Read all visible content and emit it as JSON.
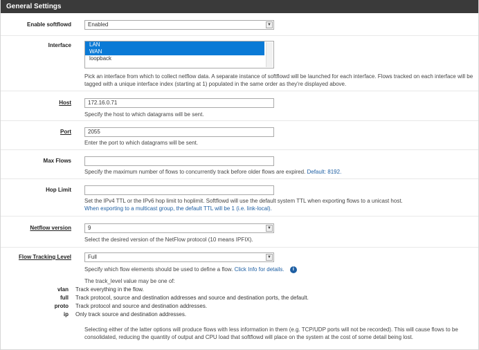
{
  "panel": {
    "title": "General Settings"
  },
  "enable": {
    "label": "Enable softflowd",
    "value": "Enabled"
  },
  "interface": {
    "label": "Interface",
    "options": [
      "LAN",
      "WAN",
      "loopback"
    ],
    "help": "Pick an interface from which to collect netflow data. A separate instance of softflowd will be launched for each interface. Flows tracked on each interface will be tagged with a unique interface index (starting at 1) populated in the same order as they're displayed above."
  },
  "host": {
    "label": "Host",
    "value": "172.16.0.71",
    "help": "Specify the host to which datagrams will be sent."
  },
  "port": {
    "label": "Port",
    "value": "2055",
    "help": "Enter the port to which datagrams will be sent."
  },
  "maxflows": {
    "label": "Max Flows",
    "value": "",
    "help": "Specify the maximum number of flows to concurrently track before older flows are expired.",
    "default_link": "Default: 8192."
  },
  "hoplimit": {
    "label": "Hop Limit",
    "value": "",
    "help": "Set the IPv4 TTL or the IPv6 hop limit to hoplimit. Softflowd will use the default system TTL when exporting flows to a unicast host.",
    "help_link": "When exporting to a multicast group, the default TTL will be 1 (i.e. link-local)."
  },
  "version": {
    "label": "Netflow version",
    "value": "9",
    "help": "Select the desired version of the NetFlow protocol (10 means IPFIX)."
  },
  "tracking": {
    "label": "Flow Tracking Level",
    "value": "Full",
    "help": "Specify which flow elements should be used to define a flow.",
    "help_link": "Click Info for details.",
    "intro": "The track_level value may be one of:",
    "levels": [
      {
        "key": "vlan",
        "desc": "Track everything in the flow."
      },
      {
        "key": "full",
        "desc": "Track protocol, source and destination addresses and source and destination ports, the default."
      },
      {
        "key": "proto",
        "desc": "Track protocol and source and destination addresses."
      },
      {
        "key": "ip",
        "desc": "Only track source and destination addresses."
      }
    ],
    "footer": "Selecting either of the latter options will produce flows with less information in them (e.g. TCP/UDP ports will not be recorded). This will cause flows to be consolidated, reducing the quantity of output and CPU load that softflowd will place on the system at the cost of some detail being lost."
  }
}
